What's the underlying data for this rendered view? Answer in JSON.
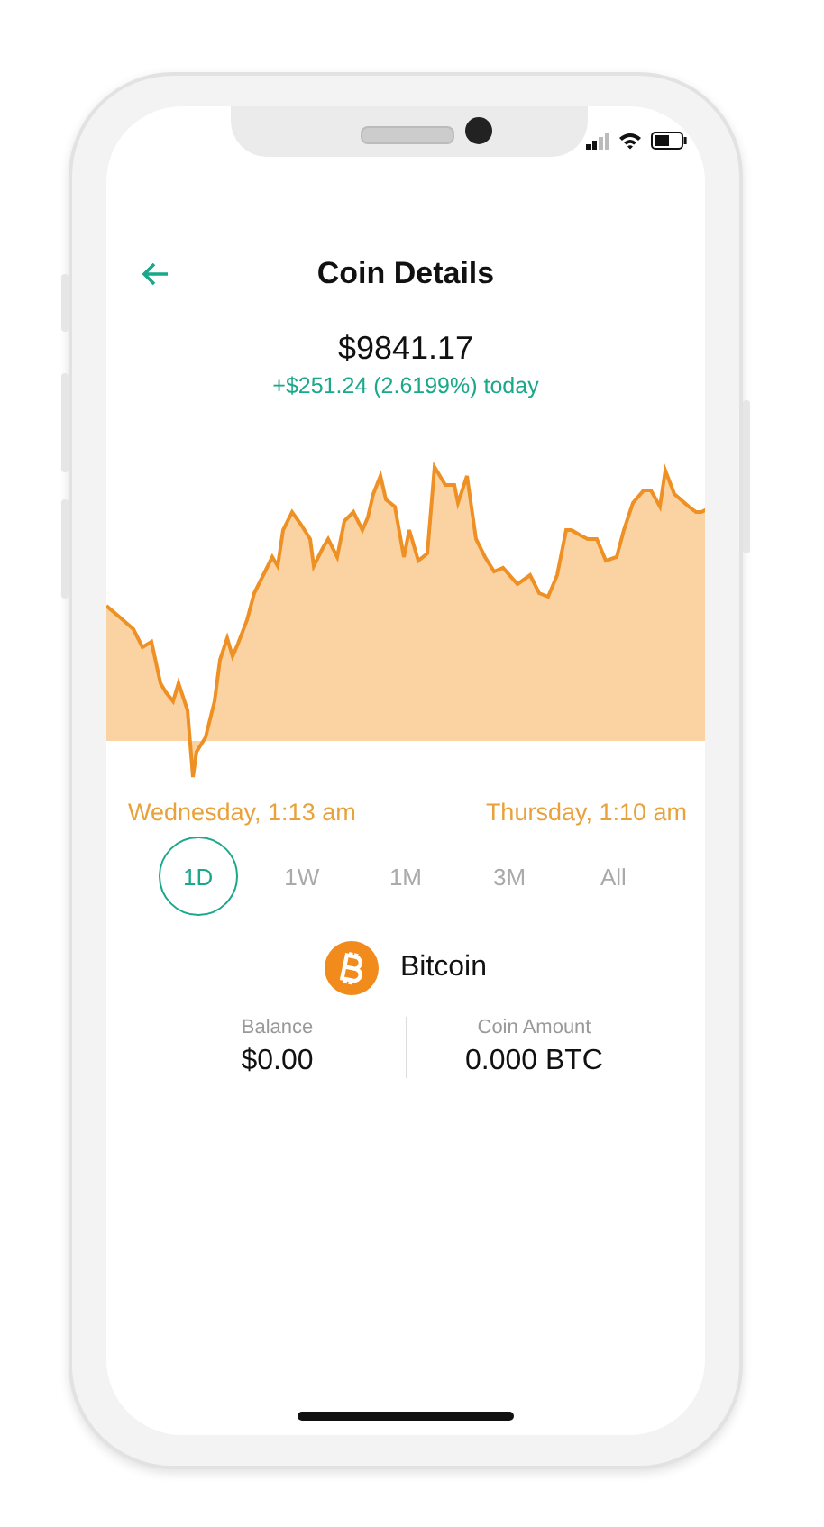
{
  "header": {
    "title": "Coin Details"
  },
  "price": "$9841.17",
  "change": "+$251.24 (2.6199%) today",
  "chart": {
    "kind": "picture",
    "start_label": "Wednesday, 1:13 am",
    "end_label": "Thursday, 1:10 am"
  },
  "ranges": [
    {
      "label": "1D",
      "selected": true
    },
    {
      "label": "1W",
      "selected": false
    },
    {
      "label": "1M",
      "selected": false
    },
    {
      "label": "3M",
      "selected": false
    },
    {
      "label": "All",
      "selected": false
    }
  ],
  "coin": {
    "name": "Bitcoin"
  },
  "stats": [
    {
      "label": "Balance",
      "value": "$0.00"
    },
    {
      "label": "Coin Amount",
      "value": "0.000 BTC"
    }
  ]
}
